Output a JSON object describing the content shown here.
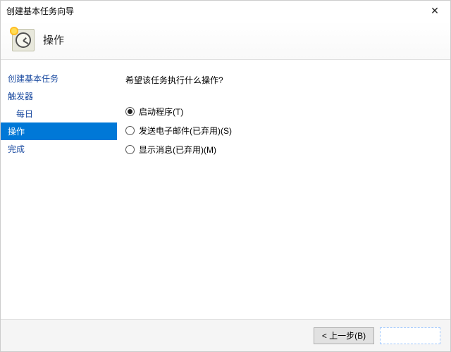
{
  "window": {
    "title": "创建基本任务向导"
  },
  "header": {
    "title": "操作"
  },
  "sidebar": {
    "items": [
      {
        "label": "创建基本任务",
        "indent": false,
        "active": false
      },
      {
        "label": "触发器",
        "indent": false,
        "active": false
      },
      {
        "label": "每日",
        "indent": true,
        "active": false
      },
      {
        "label": "操作",
        "indent": false,
        "active": true
      },
      {
        "label": "完成",
        "indent": false,
        "active": false
      }
    ]
  },
  "content": {
    "prompt": "希望该任务执行什么操作?",
    "options": [
      {
        "label": "启动程序(T)",
        "checked": true
      },
      {
        "label": "发送电子邮件(已弃用)(S)",
        "checked": false
      },
      {
        "label": "显示消息(已弃用)(M)",
        "checked": false
      }
    ]
  },
  "footer": {
    "back": "< 上一步(B)"
  }
}
